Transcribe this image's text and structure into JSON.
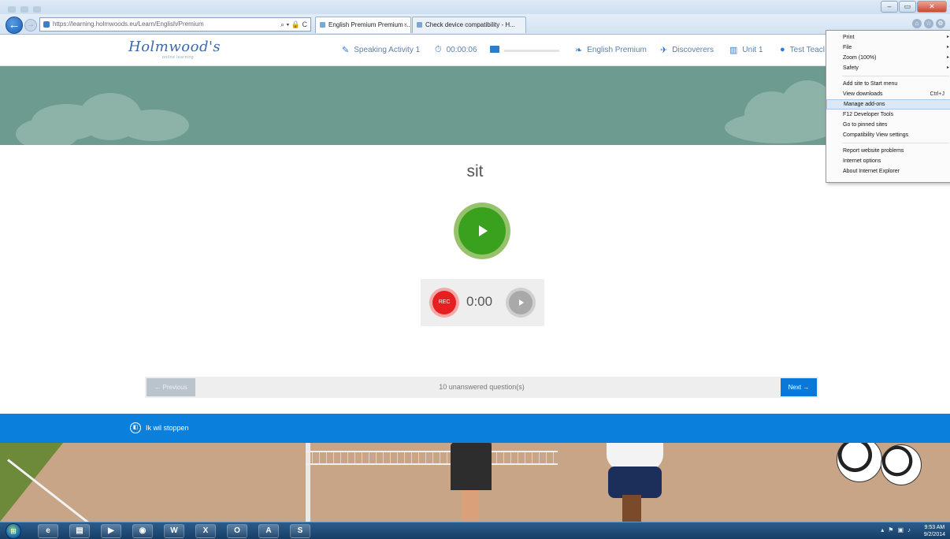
{
  "browser": {
    "url": "https://learning.holmwoods.eu/Learn/English/Premium",
    "tabs": [
      {
        "label": "English Premium Premium ...",
        "close": "×"
      },
      {
        "label": "Check device compatibility - H..."
      }
    ],
    "back_symbol": "←",
    "forward_symbol": "→",
    "address_tools": "⌕ ▾ 🔒 C"
  },
  "tools_menu": {
    "items": [
      {
        "label": "Print",
        "arrow": "▸"
      },
      {
        "label": "File",
        "arrow": "▸"
      },
      {
        "label": "Zoom (100%)",
        "arrow": "▸"
      },
      {
        "label": "Safety",
        "arrow": "▸"
      },
      {
        "label": "Add site to Start menu"
      },
      {
        "label": "View downloads",
        "shortcut": "Ctrl+J"
      },
      {
        "label": "Manage add-ons"
      },
      {
        "label": "F12 Developer Tools"
      },
      {
        "label": "Go to pinned sites"
      },
      {
        "label": "Compatibility View settings"
      },
      {
        "label": "Report website problems"
      },
      {
        "label": "Internet options"
      },
      {
        "label": "About Internet Explorer"
      }
    ]
  },
  "header": {
    "logo": "Holmwood's",
    "logo_sub": "online learning",
    "activity": "Speaking Activity 1",
    "timer": "00:00:06",
    "progress": 0,
    "course": "English Premium",
    "level": "Discoverers",
    "unit": "Unit 1",
    "user": "Test Teacl"
  },
  "content": {
    "word": "sit",
    "rec_label": "REC",
    "rec_time": "0:00"
  },
  "nav": {
    "previous": "← Previous",
    "unanswered": "10 unanswered question(s)",
    "next": "Next →"
  },
  "footer": {
    "stop_label": "Ik wil stoppen"
  },
  "taskbar": {
    "apps": [
      {
        "name": "ie",
        "glyph": "e"
      },
      {
        "name": "explorer",
        "glyph": "▤"
      },
      {
        "name": "media-player",
        "glyph": "▶"
      },
      {
        "name": "chrome",
        "glyph": "◉"
      },
      {
        "name": "word",
        "glyph": "W"
      },
      {
        "name": "excel",
        "glyph": "X"
      },
      {
        "name": "outlook",
        "glyph": "O"
      },
      {
        "name": "acrobat",
        "glyph": "A"
      },
      {
        "name": "skype",
        "glyph": "S"
      }
    ],
    "time": "9:53 AM",
    "date": "9/2/2014"
  },
  "colors": {
    "accent_blue": "#0a7fdc",
    "play_green": "#3aa11e",
    "rec_red": "#e62020",
    "hero_teal": "#6e9b8f"
  }
}
